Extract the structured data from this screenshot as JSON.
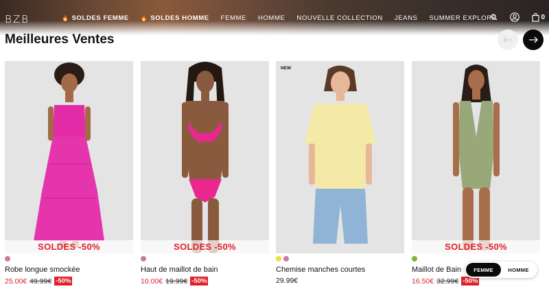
{
  "header": {
    "logo": "BZB",
    "nav": [
      {
        "label": "SOLDES FEMME",
        "sale": true
      },
      {
        "label": "SOLDES HOMME",
        "sale": true
      },
      {
        "label": "FEMME",
        "sale": false
      },
      {
        "label": "HOMME",
        "sale": false
      },
      {
        "label": "NOUVELLE COLLECTION",
        "sale": false
      },
      {
        "label": "JEANS",
        "sale": false
      },
      {
        "label": "SUMMER EXPLORE",
        "sale": false
      }
    ],
    "icons": [
      "search-icon",
      "account-icon",
      "bag-icon"
    ],
    "cart_count": "0"
  },
  "section": {
    "title": "Meilleures Ventes"
  },
  "products": [
    {
      "name": "Robe longue smockée",
      "badge": "",
      "sale_label": "SOLDES -50%",
      "swatches": [
        "#c97aa6"
      ],
      "price": "25.00€",
      "old_price": "49.99€",
      "discount": "-50%"
    },
    {
      "name": "Haut de maillot de bain",
      "badge": "",
      "sale_label": "SOLDES -50%",
      "swatches": [
        "#c97aa6"
      ],
      "price": "10.00€",
      "old_price": "19.99€",
      "discount": "-50%"
    },
    {
      "name": "Chemise manches courtes",
      "badge": "NEW",
      "sale_label": "",
      "swatches": [
        "#e8e23a",
        "#c97aa6"
      ],
      "price": "29.99€",
      "old_price": "",
      "discount": ""
    },
    {
      "name": "Maillot de Bain",
      "badge": "",
      "sale_label": "SOLDES -50%",
      "swatches": [
        "#7fb236"
      ],
      "price": "16.50€",
      "old_price": "32.99€",
      "discount": "-50%"
    }
  ],
  "gender_toggle": {
    "options": [
      "FEMME",
      "HOMME"
    ],
    "selected": "FEMME"
  },
  "colors": {
    "sale_red": "#e0202a",
    "dark": "#0a0a0a"
  }
}
